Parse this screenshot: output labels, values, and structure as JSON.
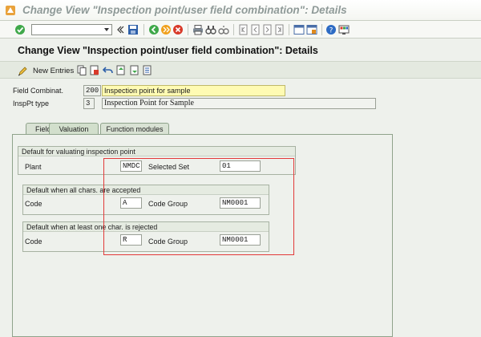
{
  "window": {
    "title": "Change View \"Inspection point/user field combination\": Details"
  },
  "command_bar": {
    "command_field_value": "",
    "icons": [
      "enter-check-icon",
      "save-icon",
      "back-icon",
      "exit-icon",
      "cancel-icon",
      "print-icon",
      "find-icon",
      "find-next-icon",
      "first-page-icon",
      "previous-page-icon",
      "next-page-icon",
      "last-page-icon",
      "new-session-icon",
      "shortcut-icon",
      "help-icon",
      "customize-layout-icon"
    ]
  },
  "screen": {
    "title": "Change View \"Inspection point/user field combination\": Details",
    "toolbar": {
      "new_entries_label": "New Entries"
    }
  },
  "header_fields": {
    "field_combination": {
      "label": "Field Combinat.",
      "value": "200",
      "description": "Inspection point for sample"
    },
    "insp_pt_type": {
      "label": "InspPt type",
      "value": "3",
      "description": "Inspection Point for Sample"
    }
  },
  "tabs": [
    {
      "label": "Fields",
      "active": false
    },
    {
      "label": "Valuation",
      "active": true
    },
    {
      "label": "Function modules",
      "active": false
    }
  ],
  "valuation": {
    "default_group": {
      "title": "Default for valuating inspection point",
      "plant_label": "Plant",
      "plant_value": "NMDC",
      "selected_set_label": "Selected Set",
      "selected_set_value": "01"
    },
    "accepted_group": {
      "title": "Default when all chars. are accepted",
      "code_label": "Code",
      "code_value": "A",
      "code_group_label": "Code Group",
      "code_group_value": "NM0001"
    },
    "rejected_group": {
      "title": "Default when at least one char. is rejected",
      "code_label": "Code",
      "code_value": "R",
      "code_group_label": "Code Group",
      "code_group_value": "NM0001"
    }
  },
  "colors": {
    "highlight_box": "#e23a3a",
    "required_field": "#fffbb3",
    "background": "#eef1ec"
  }
}
